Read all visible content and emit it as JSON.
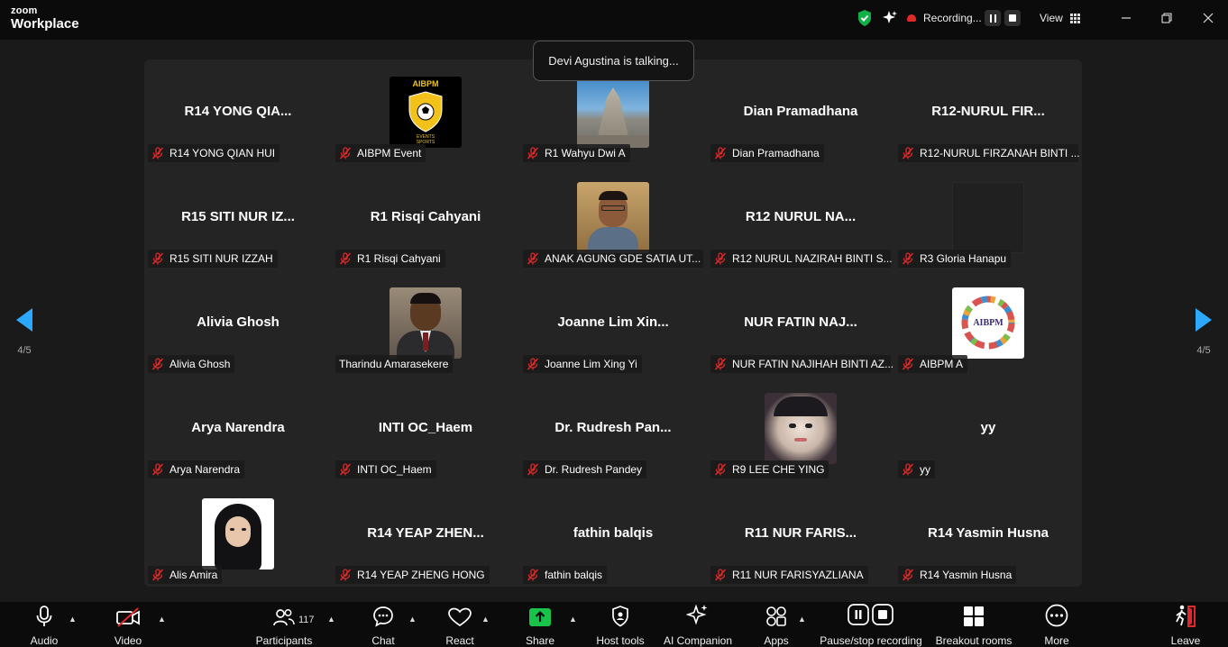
{
  "app": {
    "brand_small": "zoom",
    "brand_large": "Workplace"
  },
  "titlebar": {
    "recording_label": "Recording...",
    "view_label": "View",
    "shield_icon": "shield-check-icon",
    "ai_icon": "sparkle-icon",
    "colors": {
      "shield": "#12b048",
      "record": "#e02828"
    }
  },
  "toast": {
    "text": "Devi Agustina is talking..."
  },
  "pagination": {
    "left": "4/5",
    "right": "4/5"
  },
  "participants": [
    {
      "big": "R14 YONG QIA...",
      "label": "R14 YONG QIAN HUI",
      "muted": true
    },
    {
      "avatar": "aibpm-events-sports",
      "label": "AIBPM Event",
      "muted": true
    },
    {
      "avatar": "temple-photo",
      "label": "R1 Wahyu Dwi A",
      "muted": true
    },
    {
      "big": "Dian Pramadhana",
      "label": "Dian Pramadhana",
      "muted": true
    },
    {
      "big": "R12-NURUL FIR...",
      "label": "R12-NURUL FIRZANAH BINTI ...",
      "muted": true
    },
    {
      "big": "R15 SITI NUR IZ...",
      "label": "R15 SITI NUR IZZAH",
      "muted": true
    },
    {
      "big": "R1 Risqi Cahyani",
      "label": "R1 Risqi Cahyani",
      "muted": true
    },
    {
      "avatar": "man-glasses-photo",
      "label": "ANAK AGUNG GDE SATIA UT...",
      "muted": true
    },
    {
      "big": "R12 NURUL NA...",
      "label": "R12 NURUL NAZIRAH BINTI S...",
      "muted": true
    },
    {
      "avatar": "dark-photo",
      "label": "R3 Gloria Hanapu",
      "muted": true
    },
    {
      "big": "Alivia Ghosh",
      "label": "Alivia Ghosh",
      "muted": true
    },
    {
      "avatar": "man-suit-photo",
      "label": "Tharindu Amarasekere",
      "muted": false
    },
    {
      "big": "Joanne Lim Xin...",
      "label": "Joanne Lim Xing Yi",
      "muted": true
    },
    {
      "big": "NUR FATIN NAJ...",
      "label": "NUR FATIN NAJIHAH BINTI AZ...",
      "muted": true
    },
    {
      "avatar": "aibpm-ring-logo",
      "label": "AIBPM A",
      "muted": true
    },
    {
      "big": "Arya Narendra",
      "label": "Arya Narendra",
      "muted": true
    },
    {
      "big": "INTI OC_Haem",
      "label": "INTI OC_Haem",
      "muted": true
    },
    {
      "big": "Dr. Rudresh Pan...",
      "label": "Dr. Rudresh Pandey",
      "muted": true
    },
    {
      "avatar": "girl-filter-photo",
      "label": "R9 LEE CHE YING",
      "muted": true
    },
    {
      "big": "yy",
      "label": "yy",
      "muted": true
    },
    {
      "avatar": "hijab-woman-photo",
      "label": "Alis Amira",
      "muted": true
    },
    {
      "big": "R14 YEAP ZHEN...",
      "label": "R14 YEAP ZHENG HONG",
      "muted": true
    },
    {
      "big": "fathin balqis",
      "label": "fathin balqis",
      "muted": true
    },
    {
      "big": "R11 NUR FARIS...",
      "label": "R11 NUR FARISYAZLIANA",
      "muted": true
    },
    {
      "big": "R14 Yasmin Husna",
      "label": "R14 Yasmin Husna",
      "muted": true
    }
  ],
  "logo_texts": {
    "aibpm_top": "AIBPM",
    "aibpm_sub": "EVENTS SPORTS",
    "aibpm_ring": "AIBPM"
  },
  "toolbar": {
    "audio": "Audio",
    "video": "Video",
    "participants": "Participants",
    "participants_count": "117",
    "chat": "Chat",
    "react": "React",
    "share": "Share",
    "host_tools": "Host tools",
    "ai_companion": "AI Companion",
    "apps": "Apps",
    "pause_stop": "Pause/stop recording",
    "breakout": "Breakout rooms",
    "more": "More",
    "leave": "Leave",
    "colors": {
      "share": "#19c34a",
      "leave": "#e02828",
      "muted": "#e02828"
    }
  }
}
